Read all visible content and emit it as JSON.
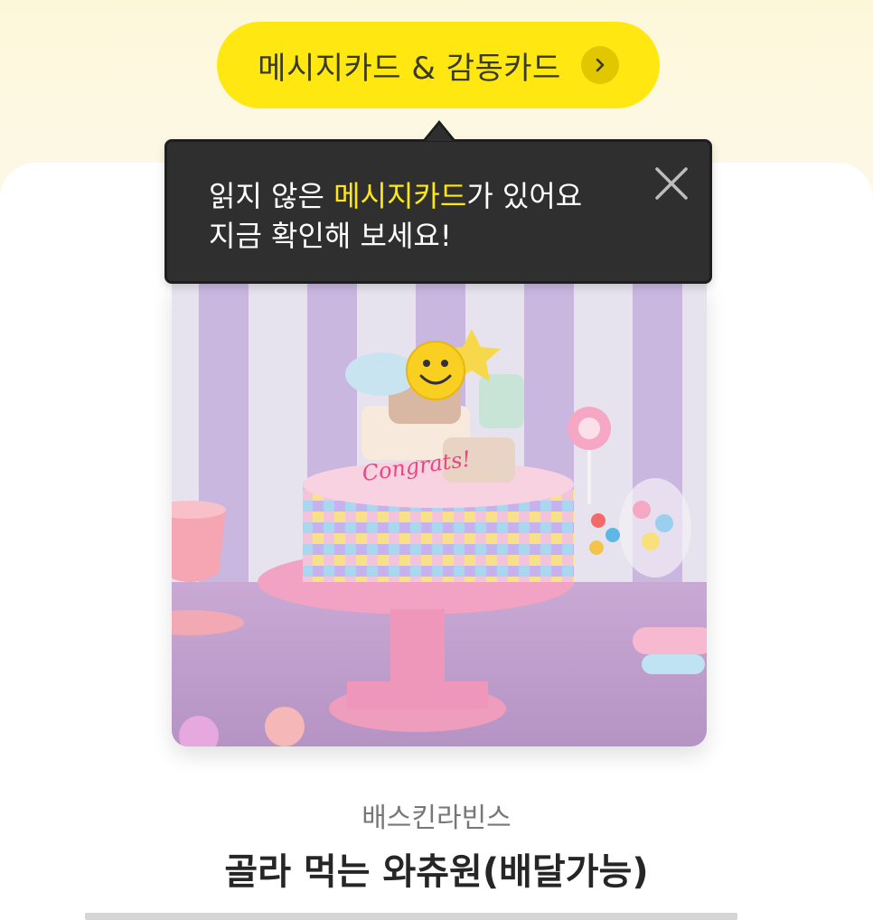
{
  "header": {
    "button_label": "메시지카드 & 감동카드",
    "button_icon": "chevron-right-icon"
  },
  "tooltip": {
    "line1_prefix": "읽지 않은 ",
    "line1_highlight": "메시지카드",
    "line1_suffix": "가 있어요",
    "line2": "지금 확인해 보세요!",
    "close_icon": "close-icon"
  },
  "product": {
    "brand": "배스킨라빈스",
    "name": "골라 먹는 와츄원(배달가능)",
    "cake_topper_text": "Congrats!"
  },
  "colors": {
    "accent_yellow": "#ffe812",
    "tooltip_bg": "#2f2f2f",
    "highlight_text": "#ffe812"
  }
}
